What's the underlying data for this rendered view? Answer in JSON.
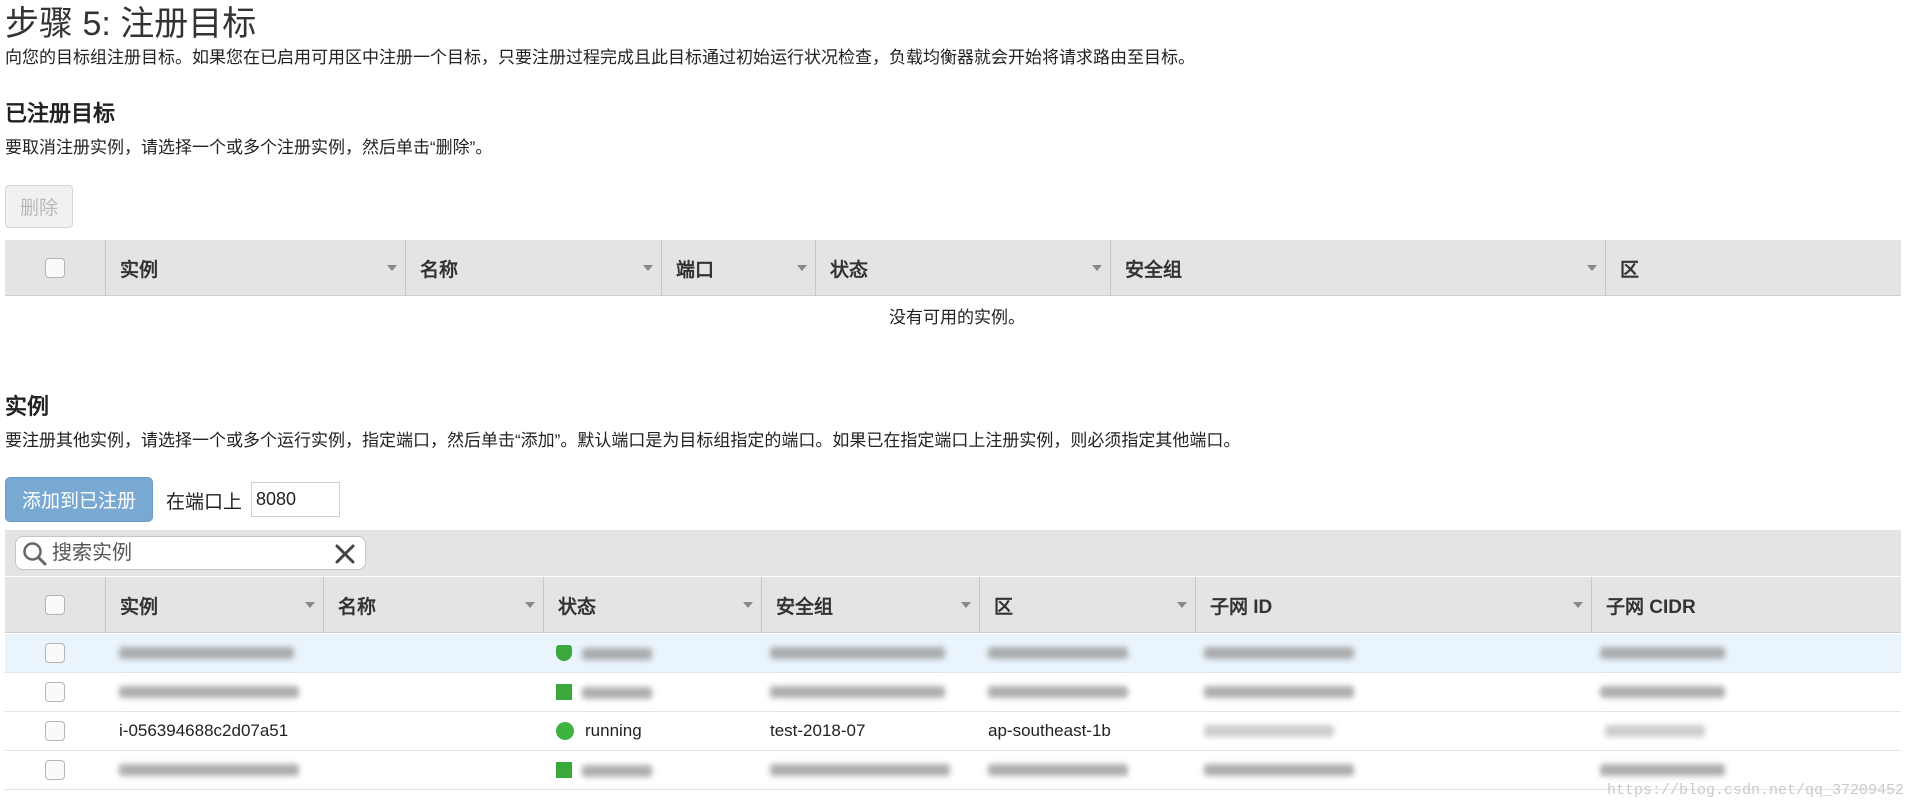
{
  "page": {
    "title": "步骤 5: 注册目标",
    "description": "向您的目标组注册目标。如果您在已启用可用区中注册一个目标，只要注册过程完成且此目标通过初始运行状况检查，负载均衡器就会开始将请求路由至目标。"
  },
  "registered": {
    "heading": "已注册目标",
    "description": "要取消注册实例，请选择一个或多个注册实例，然后单击“删除”。",
    "remove_label": "删除",
    "columns": [
      "实例",
      "名称",
      "端口",
      "状态",
      "安全组",
      "区"
    ],
    "empty_message": "没有可用的实例。"
  },
  "instances": {
    "heading": "实例",
    "description": "要注册其他实例，请选择一个或多个运行实例，指定端口，然后单击“添加”。默认端口是为目标组指定的端口。如果已在指定端口上注册实例，则必须指定其他端口。",
    "add_label": "添加到已注册",
    "port_label": "在端口上",
    "port_value": "8080",
    "search_placeholder": "搜索实例",
    "columns": [
      "实例",
      "名称",
      "状态",
      "安全组",
      "区",
      "子网 ID",
      "子网 CIDR"
    ],
    "visible_row": {
      "instance": "i-056394688c2d07a51",
      "state": "running",
      "security_group": "test-2018-07",
      "zone": "ap-southeast-1b"
    }
  },
  "watermark": "https://blog.csdn.net/qq_37209452",
  "colors": {
    "primary_button": "#79a9d2",
    "running": "#3fb33f",
    "header_bg": "#e4e4e4"
  }
}
